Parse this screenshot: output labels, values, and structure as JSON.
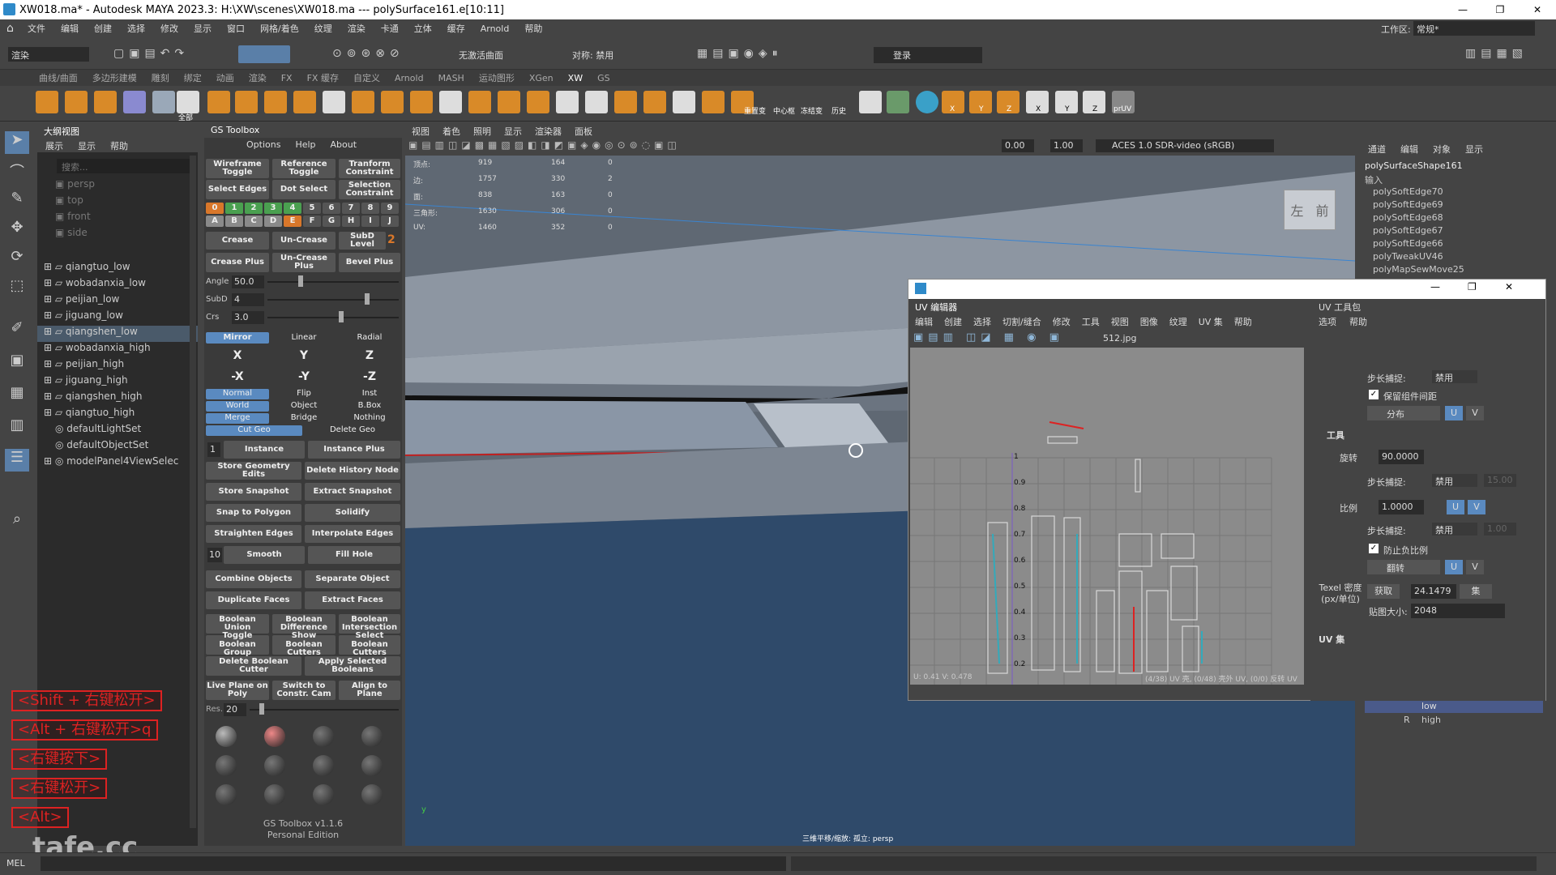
{
  "window": {
    "title": "XW018.ma* - Autodesk MAYA 2023.3: H:\\XW\\scenes\\XW018.ma   ---   polySurface161.e[10:11]",
    "min": "—",
    "max": "❐",
    "close": "✕"
  },
  "menu": [
    "文件",
    "编辑",
    "创建",
    "选择",
    "修改",
    "显示",
    "窗口",
    "网格/着色",
    "纹理",
    "渲染",
    "卡通",
    "立体",
    "缓存",
    "Arnold",
    "帮助"
  ],
  "workspace": {
    "label": "工作区:",
    "value": "常规*"
  },
  "statusline": {
    "mode": "渲染",
    "live": "无激活曲面",
    "symmetry": "对称: 禁用",
    "login": "登录"
  },
  "shelf_tabs": [
    "曲线/曲面",
    "多边形建模",
    "雕刻",
    "绑定",
    "动画",
    "渲染",
    "FX",
    "FX 缓存",
    "自定义",
    "Arnold",
    "MASH",
    "运动图形",
    "XGen",
    "XW",
    "GS"
  ],
  "shelf_active": "XW",
  "shelf_labels": [
    "全部",
    "重置变",
    "中心枢",
    "冻结变",
    "历史",
    "X",
    "Y",
    "Z",
    "X",
    "Y",
    "Z",
    "prUV"
  ],
  "outliner": {
    "title": "大纲视图",
    "menu": [
      "展示",
      "显示",
      "帮助"
    ],
    "search": "搜索...",
    "cameras": [
      "persp",
      "top",
      "front",
      "side"
    ],
    "items": [
      "qiangtuo_low",
      "wobadanxia_low",
      "peijian_low",
      "jiguang_low",
      "qiangshen_low",
      "wobadanxia_high",
      "peijian_high",
      "jiguang_high",
      "qiangshen_high",
      "qiangtuo_high",
      "defaultLightSet",
      "defaultObjectSet",
      "modelPanel4ViewSelec"
    ],
    "selected": "qiangshen_low"
  },
  "gs": {
    "title": "GS Toolbox",
    "menu": [
      "Options",
      "Help",
      "About"
    ],
    "row1": [
      "Wireframe Toggle",
      "Reference Toggle",
      "Tranform Constraint"
    ],
    "row2": [
      "Select Edges",
      "Dot Select",
      "Selection Constraint"
    ],
    "nums": [
      "0",
      "1",
      "2",
      "3",
      "4",
      "5",
      "6",
      "7",
      "8",
      "9"
    ],
    "letters": [
      "A",
      "B",
      "C",
      "D",
      "E",
      "F",
      "G",
      "H",
      "I",
      "J"
    ],
    "crease": [
      "Crease",
      "Un-Crease",
      "SubD Level"
    ],
    "subd_value": "2",
    "crease2": [
      "Crease Plus",
      "Un-Crease Plus",
      "Bevel Plus"
    ],
    "sliders": [
      {
        "label": "Angle",
        "value": "50.0"
      },
      {
        "label": "SubD",
        "value": "4"
      },
      {
        "label": "Crs",
        "value": "3.0"
      }
    ],
    "mirror": [
      "Mirror",
      "Linear",
      "Radial"
    ],
    "axes": [
      "X",
      "Y",
      "Z"
    ],
    "naxes": [
      "-X",
      "-Y",
      "-Z"
    ],
    "opts1": [
      "Normal",
      "Flip",
      "Inst"
    ],
    "opts2": [
      "World",
      "Object",
      "B.Box"
    ],
    "opts3": [
      "Merge",
      "Bridge",
      "Nothing"
    ],
    "opts4": [
      "Cut Geo",
      "Delete Geo"
    ],
    "instance_num": "1",
    "instance": [
      "Instance",
      "Instance Plus"
    ],
    "store": [
      "Store Geometry Edits",
      "Delete History Node"
    ],
    "snap": [
      "Store Snapshot",
      "Extract Snapshot"
    ],
    "poly": [
      "Snap to Polygon",
      "Solidify"
    ],
    "edges": [
      "Straighten Edges",
      "Interpolate Edges"
    ],
    "smooth_num": "10",
    "smooth": [
      "Smooth",
      "Fill Hole"
    ],
    "combine": [
      "Combine Objects",
      "Separate Object"
    ],
    "dup": [
      "Duplicate Faces",
      "Extract Faces"
    ],
    "bool": [
      "Boolean Union",
      "Boolean Difference",
      "Boolean Intersection"
    ],
    "bool2": [
      "Toggle Boolean Group",
      "Show Boolean Cutters",
      "Select Boolean Cutters"
    ],
    "bool3": [
      "Delete Boolean Cutter",
      "Apply Selected Booleans"
    ],
    "plane": [
      "Live Plane on Poly",
      "Switch to Constr. Cam",
      "Align to Plane"
    ],
    "res_label": "Res.",
    "res_value": "20",
    "footer1": "GS Toolbox v1.1.6",
    "footer2": "Personal Edition"
  },
  "viewport": {
    "menu": [
      "视图",
      "着色",
      "照明",
      "显示",
      "渲染器",
      "面板"
    ],
    "val1": "0.00",
    "val2": "1.00",
    "colorspace": "ACES 1.0 SDR-video (sRGB)",
    "hud": [
      {
        "label": "顶点:",
        "a": "919",
        "b": "164",
        "c": "0"
      },
      {
        "label": "边:",
        "a": "1757",
        "b": "330",
        "c": "2"
      },
      {
        "label": "面:",
        "a": "838",
        "b": "163",
        "c": "0"
      },
      {
        "label": "三角形:",
        "a": "1630",
        "b": "306",
        "c": "0"
      },
      {
        "label": "UV:",
        "a": "1460",
        "b": "352",
        "c": "0"
      }
    ],
    "cube_left": "左",
    "cube_front": "前",
    "camera": "三维平移/缩放: 孤立: persp"
  },
  "hotkeys": [
    "<Shift + 右键松开>",
    "<Alt + 右键松开>q",
    "<右键按下>",
    "<右键松开>",
    "<Alt>"
  ],
  "watermark": "tafe.cc",
  "mel": "MEL",
  "attr": {
    "menu": [
      "通道",
      "编辑",
      "对象",
      "显示"
    ],
    "shape": "polySurfaceShape161",
    "input": "输入",
    "nodes": [
      "polySoftEdge70",
      "polySoftEdge69",
      "polySoftEdge68",
      "polySoftEdge67",
      "polySoftEdge66",
      "polyTweakUV46",
      "polyMapSewMove25"
    ],
    "layers": [
      "low",
      "high"
    ],
    "layer_r": "R"
  },
  "uv": {
    "title": "UV 编辑器",
    "menu": [
      "编辑",
      "创建",
      "选择",
      "切割/缝合",
      "修改",
      "工具",
      "视图",
      "图像",
      "纹理",
      "UV 集",
      "帮助"
    ],
    "texture": "512.jpg",
    "ticks": [
      "1",
      "0.9",
      "0.8",
      "0.7",
      "0.6",
      "0.5",
      "0.4",
      "0.3",
      "0.2"
    ],
    "footer": "U: 0.41 V: 0.478",
    "footer2": "(4/38) UV 壳, (0/48) 壳外 UV, (0/0) 反转 UV",
    "tk_title": "UV 工具包",
    "tk_menu": [
      "选项",
      "帮助"
    ],
    "step_label": "步长捕捉:",
    "step_value": "禁用",
    "keep": "保留组件间距",
    "distribute": "分布",
    "tools": "工具",
    "rotate_label": "旋转",
    "rotate_value": "90.0000",
    "step2": "15.00",
    "scale_label": "比例",
    "scale_value": "1.0000",
    "step3": "1.00",
    "prevent": "防止负比例",
    "flip": "翻转",
    "texel_label": "Texel 密度 (px/单位)",
    "texel_get": "获取",
    "texel_value": "24.1479",
    "texel_set": "集",
    "map_label": "贴图大小:",
    "map_value": "2048",
    "uvset": "UV 集",
    "u": "U",
    "v": "V"
  }
}
